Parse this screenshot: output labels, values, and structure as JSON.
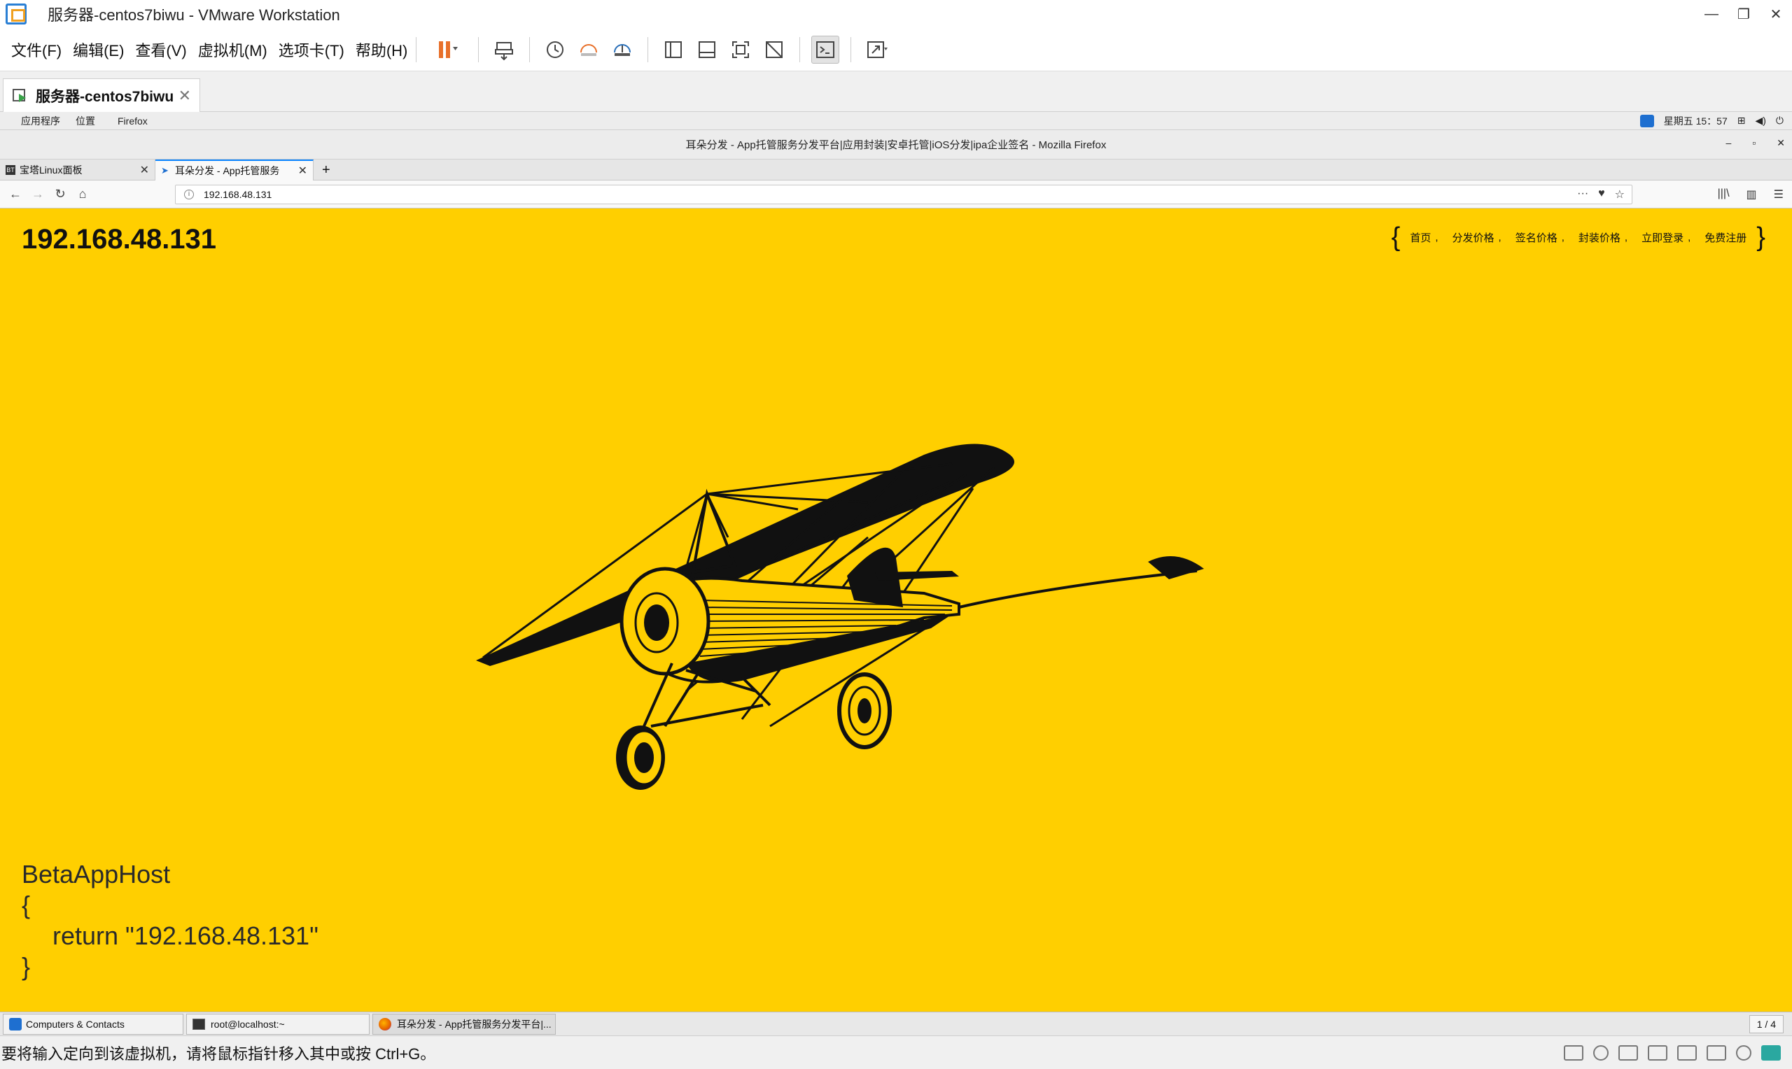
{
  "vmware": {
    "window_title": "服务器-centos7biwu - VMware Workstation",
    "menus": [
      "文件(F)",
      "编辑(E)",
      "查看(V)",
      "虚拟机(M)",
      "选项卡(T)",
      "帮助(H)"
    ],
    "vm_tab_label": "服务器-centos7biwu",
    "status_text": "要将输入定向到该虚拟机，请将鼠标指针移入其中或按 Ctrl+G。"
  },
  "gnome": {
    "applications": "应用程序",
    "places": "位置",
    "firefox": "Firefox",
    "clock": "星期五 15：57"
  },
  "firefox": {
    "window_title": "耳朵分发 - App托管服务分发平台|应用封装|安卓托管|iOS分发|ipa企业签名 - Mozilla Firefox",
    "tabs": [
      {
        "label": "宝塔Linux面板"
      },
      {
        "label": "耳朵分发 - App托管服务"
      }
    ],
    "new_tab": "+",
    "url": "192.168.48.131"
  },
  "page": {
    "site_ip": "192.168.48.131",
    "nav": [
      "首页",
      "分发价格",
      "签名价格",
      "封装价格",
      "立即登录",
      "免费注册"
    ],
    "code_name": "BetaAppHost",
    "code_open": "{",
    "code_return": "return \"192.168.48.131\"",
    "code_close": "}",
    "colors": {
      "background": "#ffcf00",
      "text": "#111111"
    }
  },
  "taskbar": {
    "items": [
      "Computers & Contacts",
      "root@localhost:~",
      "耳朵分发 - App托管服务分发平台|..."
    ],
    "workspace": "1 / 4"
  }
}
